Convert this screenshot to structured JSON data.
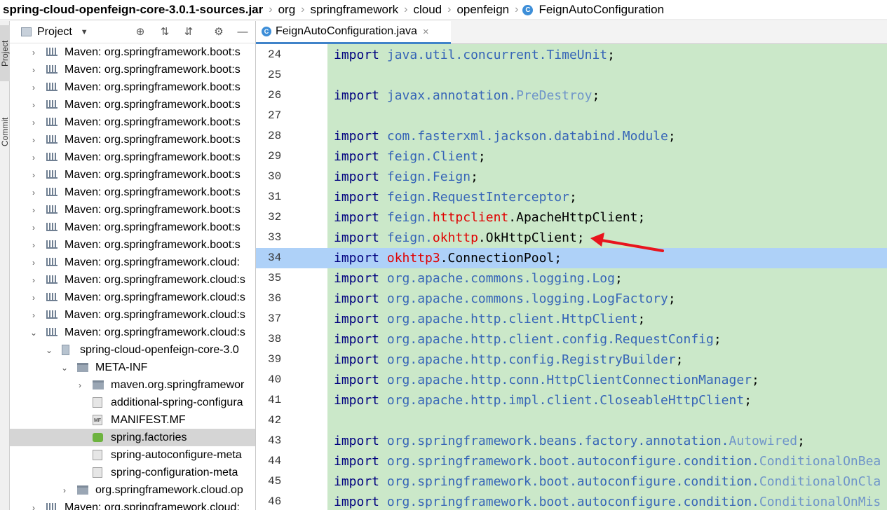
{
  "breadcrumb": {
    "items": [
      "spring-cloud-openfeign-core-3.0.1-sources.jar",
      "org",
      "springframework",
      "cloud",
      "openfeign",
      "FeignAutoConfiguration"
    ],
    "class_badge": "C"
  },
  "side_strip": {
    "project_tab": "Project",
    "commit_tab": "Commit"
  },
  "project_panel": {
    "title": "Project",
    "toolbar_icons": [
      "locate-icon",
      "expand-all-icon",
      "collapse-all-icon",
      "gear-icon",
      "minimize-icon"
    ],
    "tree": [
      {
        "label": "Maven: org.springframework.boot:s",
        "arrow": "›",
        "type": "lib"
      },
      {
        "label": "Maven: org.springframework.boot:s",
        "arrow": "›",
        "type": "lib"
      },
      {
        "label": "Maven: org.springframework.boot:s",
        "arrow": "›",
        "type": "lib"
      },
      {
        "label": "Maven: org.springframework.boot:s",
        "arrow": "›",
        "type": "lib"
      },
      {
        "label": "Maven: org.springframework.boot:s",
        "arrow": "›",
        "type": "lib"
      },
      {
        "label": "Maven: org.springframework.boot:s",
        "arrow": "›",
        "type": "lib"
      },
      {
        "label": "Maven: org.springframework.boot:s",
        "arrow": "›",
        "type": "lib"
      },
      {
        "label": "Maven: org.springframework.boot:s",
        "arrow": "›",
        "type": "lib"
      },
      {
        "label": "Maven: org.springframework.boot:s",
        "arrow": "›",
        "type": "lib"
      },
      {
        "label": "Maven: org.springframework.boot:s",
        "arrow": "›",
        "type": "lib"
      },
      {
        "label": "Maven: org.springframework.boot:s",
        "arrow": "›",
        "type": "lib"
      },
      {
        "label": "Maven: org.springframework.boot:s",
        "arrow": "›",
        "type": "lib"
      },
      {
        "label": "Maven: org.springframework.cloud:",
        "arrow": "›",
        "type": "lib"
      },
      {
        "label": "Maven: org.springframework.cloud:s",
        "arrow": "›",
        "type": "lib"
      },
      {
        "label": "Maven: org.springframework.cloud:s",
        "arrow": "›",
        "type": "lib"
      },
      {
        "label": "Maven: org.springframework.cloud:s",
        "arrow": "›",
        "type": "lib"
      },
      {
        "label": "Maven: org.springframework.cloud:s",
        "arrow": "⌄",
        "type": "lib"
      },
      {
        "label": "spring-cloud-openfeign-core-3.0",
        "arrow": "⌄",
        "type": "jar"
      },
      {
        "label": "META-INF",
        "arrow": "⌄",
        "type": "dir"
      },
      {
        "label": "maven.org.springframewor",
        "arrow": "›",
        "type": "dir"
      },
      {
        "label": "additional-spring-configura",
        "arrow": "",
        "type": "file",
        "badge": ""
      },
      {
        "label": "MANIFEST.MF",
        "arrow": "",
        "type": "file",
        "badge": "MF"
      },
      {
        "label": "spring.factories",
        "arrow": "",
        "type": "spring"
      },
      {
        "label": "spring-autoconfigure-meta",
        "arrow": "",
        "type": "file",
        "badge": ""
      },
      {
        "label": "spring-configuration-meta",
        "arrow": "",
        "type": "file",
        "badge": ""
      },
      {
        "label": "org.springframework.cloud.op",
        "arrow": "›",
        "type": "dir"
      },
      {
        "label": "Maven: org.springframework.cloud:",
        "arrow": "›",
        "type": "lib"
      }
    ],
    "selected_index": 22
  },
  "editor": {
    "tab": {
      "label": "FeignAutoConfiguration.java",
      "close": "×",
      "badge": "C"
    },
    "current_line": 34,
    "lines": [
      {
        "num": "24",
        "tokens": [
          {
            "t": "import ",
            "c": "kw"
          },
          {
            "t": "java.util.concurrent.TimeUnit",
            "c": "pk"
          },
          {
            "t": ";",
            "c": "cls"
          }
        ]
      },
      {
        "num": "25",
        "tokens": []
      },
      {
        "num": "26",
        "tokens": [
          {
            "t": "import ",
            "c": "kw"
          },
          {
            "t": "javax.annotation.",
            "c": "pk"
          },
          {
            "t": "PreDestroy",
            "c": "pk dim"
          },
          {
            "t": ";",
            "c": "cls"
          }
        ]
      },
      {
        "num": "27",
        "tokens": []
      },
      {
        "num": "28",
        "tokens": [
          {
            "t": "import ",
            "c": "kw"
          },
          {
            "t": "com.fasterxml.jackson.databind.Module",
            "c": "pk"
          },
          {
            "t": ";",
            "c": "cls"
          }
        ]
      },
      {
        "num": "29",
        "tokens": [
          {
            "t": "import ",
            "c": "kw"
          },
          {
            "t": "feign.Client",
            "c": "pk"
          },
          {
            "t": ";",
            "c": "cls"
          }
        ]
      },
      {
        "num": "30",
        "tokens": [
          {
            "t": "import ",
            "c": "kw"
          },
          {
            "t": "feign.Feign",
            "c": "pk"
          },
          {
            "t": ";",
            "c": "cls"
          }
        ]
      },
      {
        "num": "31",
        "tokens": [
          {
            "t": "import ",
            "c": "kw"
          },
          {
            "t": "feign.RequestInterceptor",
            "c": "pk"
          },
          {
            "t": ";",
            "c": "cls"
          }
        ]
      },
      {
        "num": "32",
        "tokens": [
          {
            "t": "import ",
            "c": "kw"
          },
          {
            "t": "feign.",
            "c": "pk"
          },
          {
            "t": "httpclient",
            "c": "red"
          },
          {
            "t": ".ApacheHttpClient;",
            "c": "cls"
          }
        ]
      },
      {
        "num": "33",
        "tokens": [
          {
            "t": "import ",
            "c": "kw"
          },
          {
            "t": "feign.",
            "c": "pk"
          },
          {
            "t": "okhttp",
            "c": "red"
          },
          {
            "t": ".OkHttpClient;",
            "c": "cls"
          }
        ]
      },
      {
        "num": "34",
        "tokens": [
          {
            "t": "import ",
            "c": "kw"
          },
          {
            "t": "okhttp3",
            "c": "red"
          },
          {
            "t": ".ConnectionPool;",
            "c": "cls"
          }
        ]
      },
      {
        "num": "35",
        "tokens": [
          {
            "t": "import ",
            "c": "kw"
          },
          {
            "t": "org.apache.commons.logging.Log",
            "c": "pk"
          },
          {
            "t": ";",
            "c": "cls"
          }
        ]
      },
      {
        "num": "36",
        "tokens": [
          {
            "t": "import ",
            "c": "kw"
          },
          {
            "t": "org.apache.commons.logging.LogFactory",
            "c": "pk"
          },
          {
            "t": ";",
            "c": "cls"
          }
        ]
      },
      {
        "num": "37",
        "tokens": [
          {
            "t": "import ",
            "c": "kw"
          },
          {
            "t": "org.apache.http.client.HttpClient",
            "c": "pk"
          },
          {
            "t": ";",
            "c": "cls"
          }
        ]
      },
      {
        "num": "38",
        "tokens": [
          {
            "t": "import ",
            "c": "kw"
          },
          {
            "t": "org.apache.http.client.config.RequestConfig",
            "c": "pk"
          },
          {
            "t": ";",
            "c": "cls"
          }
        ]
      },
      {
        "num": "39",
        "tokens": [
          {
            "t": "import ",
            "c": "kw"
          },
          {
            "t": "org.apache.http.config.RegistryBuilder",
            "c": "pk"
          },
          {
            "t": ";",
            "c": "cls"
          }
        ]
      },
      {
        "num": "40",
        "tokens": [
          {
            "t": "import ",
            "c": "kw"
          },
          {
            "t": "org.apache.http.conn.HttpClientConnectionManager",
            "c": "pk"
          },
          {
            "t": ";",
            "c": "cls"
          }
        ]
      },
      {
        "num": "41",
        "tokens": [
          {
            "t": "import ",
            "c": "kw"
          },
          {
            "t": "org.apache.http.impl.client.CloseableHttpClient",
            "c": "pk"
          },
          {
            "t": ";",
            "c": "cls"
          }
        ]
      },
      {
        "num": "42",
        "tokens": []
      },
      {
        "num": "43",
        "tokens": [
          {
            "t": "import ",
            "c": "kw"
          },
          {
            "t": "org.springframework.beans.factory.annotation.",
            "c": "pk"
          },
          {
            "t": "Autowired",
            "c": "pk dim"
          },
          {
            "t": ";",
            "c": "cls"
          }
        ]
      },
      {
        "num": "44",
        "tokens": [
          {
            "t": "import ",
            "c": "kw"
          },
          {
            "t": "org.springframework.boot.autoconfigure.condition.",
            "c": "pk"
          },
          {
            "t": "ConditionalOnBea",
            "c": "pk dim"
          }
        ]
      },
      {
        "num": "45",
        "tokens": [
          {
            "t": "import ",
            "c": "kw"
          },
          {
            "t": "org.springframework.boot.autoconfigure.condition.",
            "c": "pk"
          },
          {
            "t": "ConditionalOnCla",
            "c": "pk dim"
          }
        ]
      },
      {
        "num": "46",
        "tokens": [
          {
            "t": "import ",
            "c": "kw"
          },
          {
            "t": "org.springframework.boot.autoconfigure.condition.",
            "c": "pk"
          },
          {
            "t": "ConditionalOnMis",
            "c": "pk dim"
          }
        ]
      }
    ],
    "annotation": {
      "type": "red-arrow",
      "points_to_line": 33
    }
  }
}
